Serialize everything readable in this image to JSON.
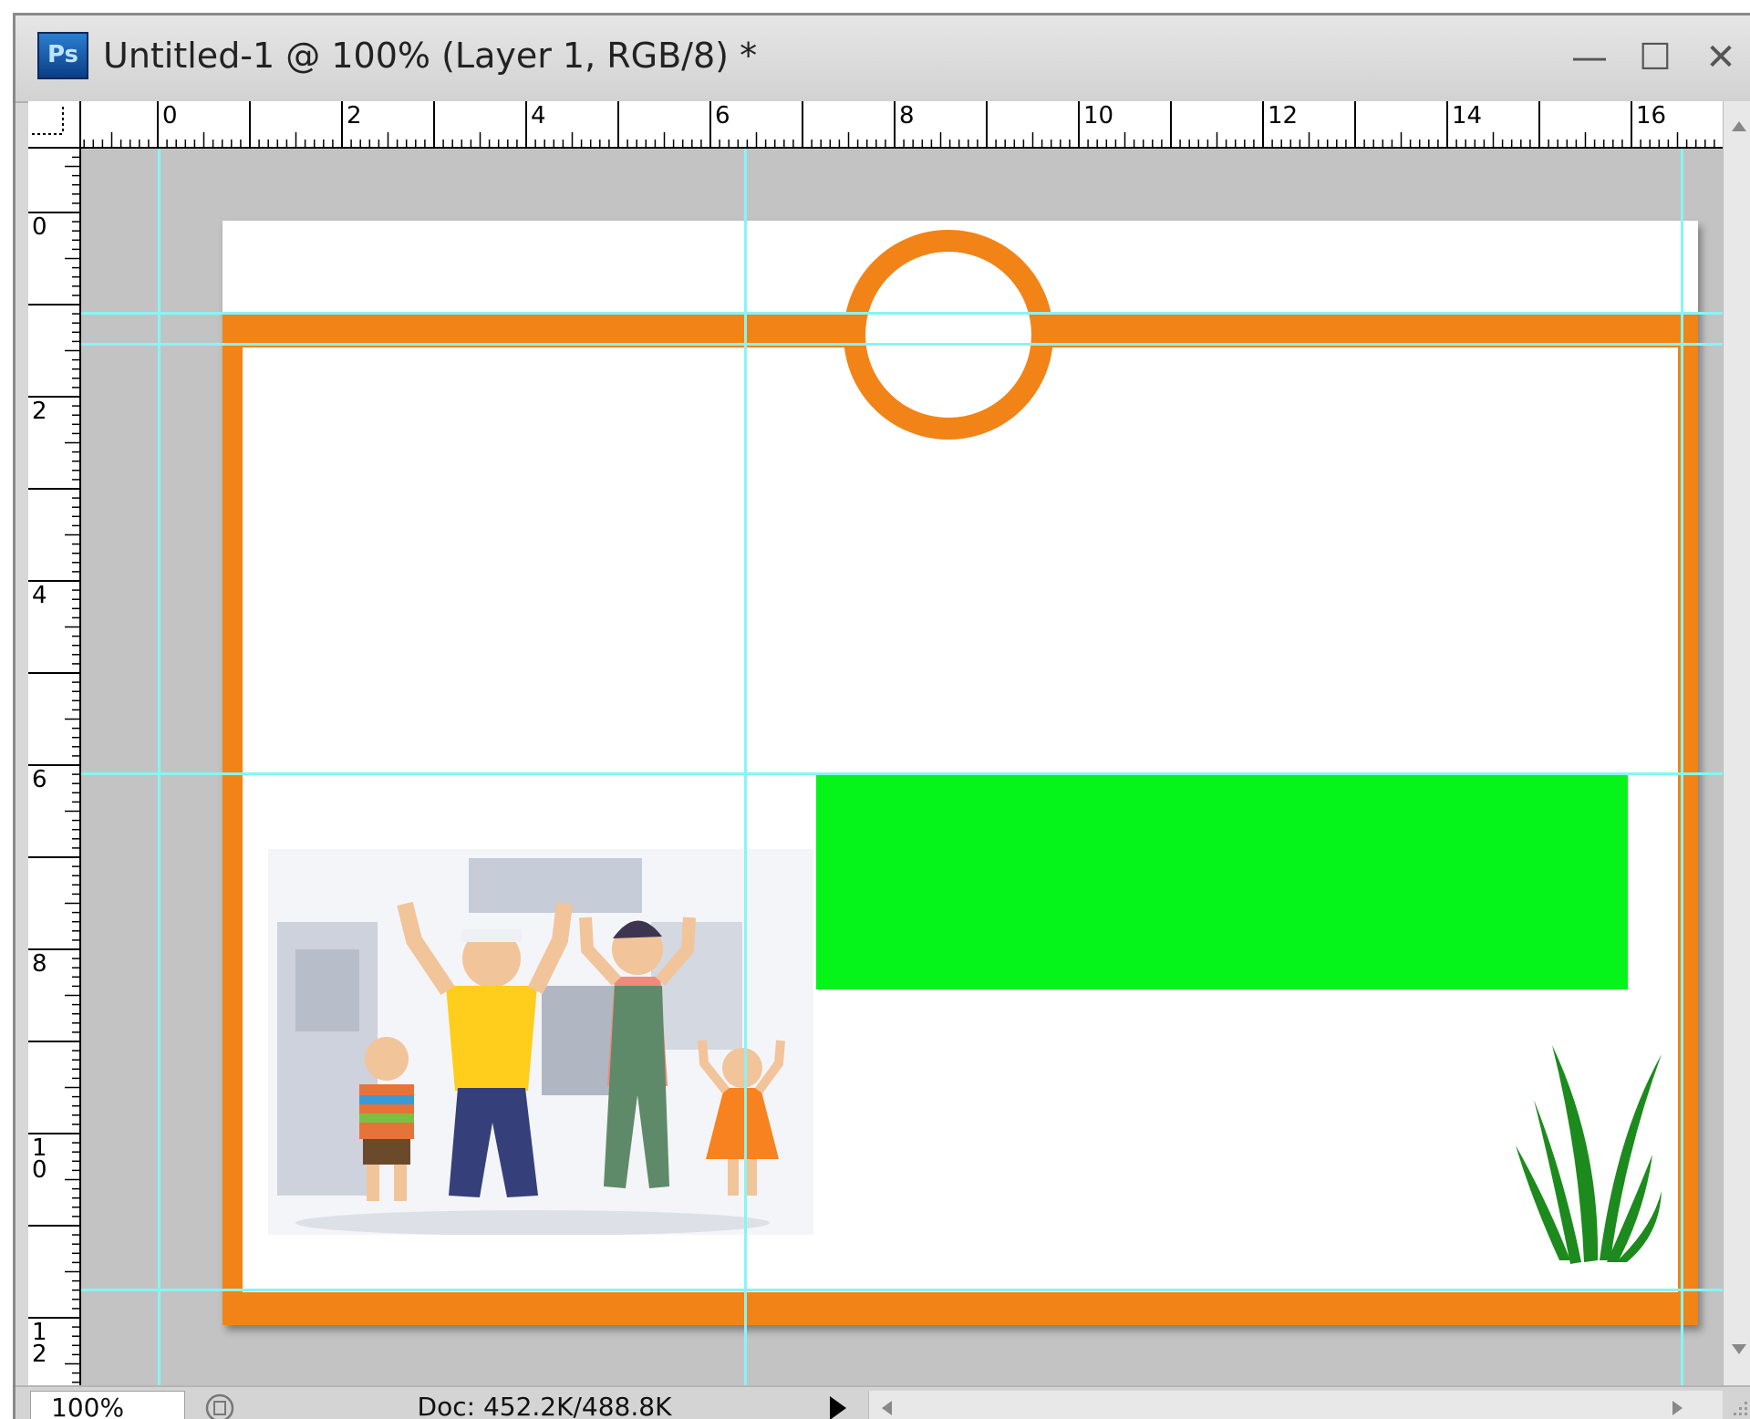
{
  "window": {
    "title": "Untitled-1 @ 100% (Layer 1, RGB/8) *",
    "app_logo": "Ps",
    "controls": {
      "minimize": "—",
      "maximize": "☐",
      "close": "✕"
    }
  },
  "rulers": {
    "horizontal_labels": [
      "0",
      "2",
      "4",
      "6",
      "8",
      "10",
      "12",
      "14",
      "16"
    ],
    "vertical_labels": [
      "0",
      "2",
      "4",
      "6",
      "8",
      "1\n0",
      "1\n2"
    ],
    "unit": "cm"
  },
  "canvas": {
    "background": "#c3c3c3",
    "document_background": "#ffffff",
    "frame_color": "#f28316",
    "green_box_color": "#05f51a",
    "guide_color": "#86f5f5",
    "layers": [
      {
        "name": "orange-frame",
        "icon": "rectangle-outline"
      },
      {
        "name": "orange-circle",
        "icon": "circle-outline"
      },
      {
        "name": "green-rectangle",
        "icon": "rectangle"
      },
      {
        "name": "family-illustration",
        "icon": "image"
      },
      {
        "name": "grass-clipart",
        "icon": "grass"
      }
    ]
  },
  "status": {
    "zoom": "100%",
    "doc_info": "Doc: 452.2K/488.8K",
    "menu_arrow": "play-triangle-icon"
  }
}
